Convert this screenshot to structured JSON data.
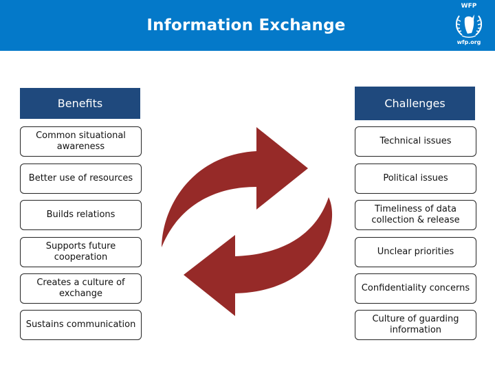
{
  "header": {
    "title": "Information Exchange",
    "logo": {
      "top_text": "WFP",
      "bottom_text": "wfp.org",
      "icon": "wfp-emblem-icon"
    },
    "background_color": "#0479c9"
  },
  "benefits": {
    "title": "Benefits",
    "items": [
      "Common situational awareness",
      "Better use of resources",
      "Builds relations",
      "Supports future cooperation",
      "Creates a culture of exchange",
      "Sustains communication"
    ]
  },
  "challenges": {
    "title": "Challenges",
    "items": [
      "Technical issues",
      "Political issues",
      "Timeliness of data collection & release",
      "Unclear priorities",
      "Confidentiality concerns",
      "Culture of guarding information"
    ]
  },
  "center_graphic": {
    "icon": "circular-exchange-arrows-icon",
    "color": "#962a28"
  },
  "colors": {
    "column_header": "#1f497d"
  }
}
